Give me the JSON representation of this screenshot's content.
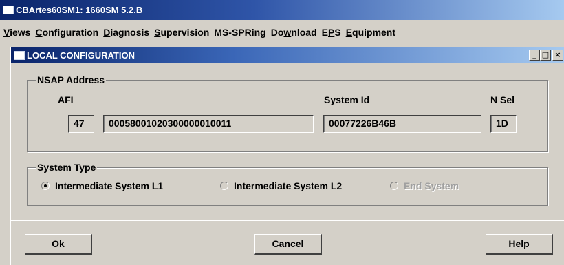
{
  "app": {
    "title": "CBArtes60SM1: 1660SM 5.2.B"
  },
  "menubar": {
    "items": [
      {
        "accel": "V",
        "rest": "iews"
      },
      {
        "accel": "C",
        "rest": "onfiguration"
      },
      {
        "accel": "D",
        "rest": "iagnosis"
      },
      {
        "accel": "S",
        "rest": "upervision"
      },
      {
        "pre": "MS-SPRing",
        "accel": "",
        "rest": ""
      },
      {
        "pre": "Do",
        "accel": "w",
        "rest": "nload"
      },
      {
        "pre": "E",
        "accel": "P",
        "rest": "S"
      },
      {
        "accel": "E",
        "rest": "quipment"
      }
    ]
  },
  "dialog": {
    "title": "LOCAL CONFIGURATION",
    "controls": {
      "minimize": "_",
      "maximize": "□",
      "close": "×"
    }
  },
  "nsap": {
    "legend": "NSAP Address",
    "afi_label": "AFI",
    "system_id_label": "System Id",
    "nsel_label": "N Sel",
    "afi_value": "47",
    "area_value": "00058001020300000010011",
    "system_id_value": "00077226B46B",
    "nsel_value": "1D"
  },
  "system_type": {
    "legend": "System Type",
    "options": [
      {
        "label": "Intermediate System L1",
        "checked": true,
        "enabled": true
      },
      {
        "label": "Intermediate System L2",
        "checked": false,
        "enabled": true
      },
      {
        "label": "End System",
        "checked": false,
        "enabled": false
      }
    ]
  },
  "buttons": {
    "ok": "Ok",
    "cancel": "Cancel",
    "help": "Help"
  }
}
